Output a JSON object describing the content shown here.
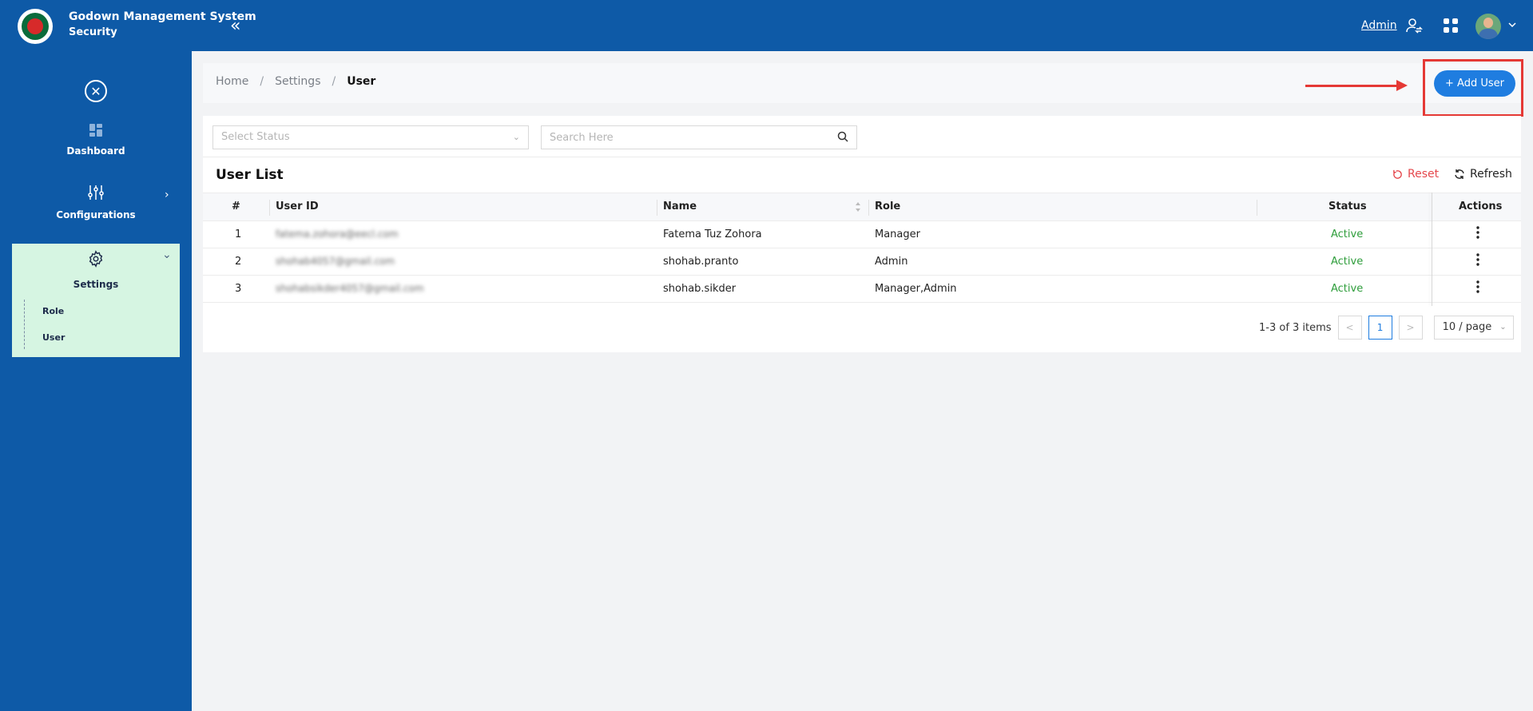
{
  "header": {
    "app_title": "Godown Management System",
    "app_subtitle": "Security",
    "collapse_glyph": "«",
    "user_link": "Admin",
    "brand_color": "#0e5aa7"
  },
  "sidebar": {
    "close_glyph": "✕",
    "items": [
      {
        "label": "Dashboard",
        "icon": "dashboard-icon"
      },
      {
        "label": "Configurations",
        "icon": "sliders-icon"
      },
      {
        "label": "Settings",
        "icon": "gear-icon"
      }
    ],
    "settings_sub": [
      {
        "label": "Role"
      },
      {
        "label": "User"
      }
    ],
    "active_bg": "#d6f5e2"
  },
  "breadcrumb": {
    "items": [
      "Home",
      "Settings",
      "User"
    ],
    "separator": "/"
  },
  "toolbar": {
    "add_user_label": "+ Add User",
    "accent": "#1f7de0",
    "highlight_color": "#e53935"
  },
  "filters": {
    "status_placeholder": "Select Status",
    "search_placeholder": "Search Here"
  },
  "list": {
    "title": "User List",
    "reset_label": "Reset",
    "refresh_label": "Refresh",
    "columns": [
      "#",
      "User ID",
      "Name",
      "Role",
      "Status",
      "Actions"
    ],
    "rows": [
      {
        "index": "1",
        "user_id": "fatema.zohora@eecl.com",
        "name": "Fatema Tuz Zohora",
        "role": "Manager",
        "status": "Active"
      },
      {
        "index": "2",
        "user_id": "shohab4057@gmail.com",
        "name": "shohab.pranto",
        "role": "Admin",
        "status": "Active"
      },
      {
        "index": "3",
        "user_id": "shohabsikder4057@gmail.com",
        "name": "shohab.sikder",
        "role": "Manager,Admin",
        "status": "Active"
      }
    ],
    "status_color": "#2e9d3b"
  },
  "pagination": {
    "range_text": "1-3 of 3 items",
    "prev": "<",
    "current_page": "1",
    "next": ">",
    "page_size": "10 / page"
  }
}
